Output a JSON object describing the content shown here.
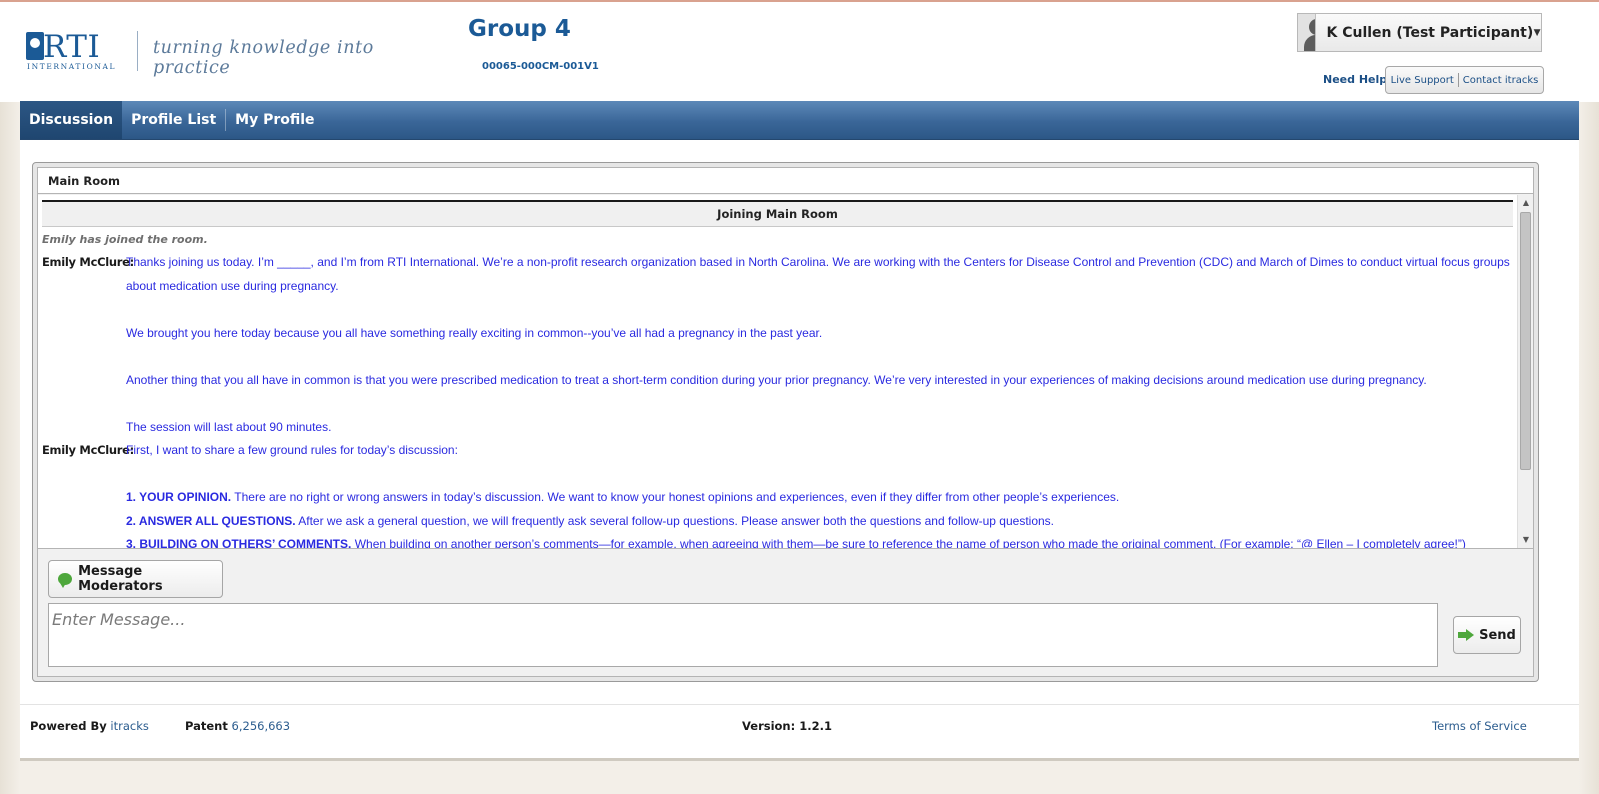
{
  "header": {
    "logo_text": "RTI",
    "logo_subtext": "INTERNATIONAL",
    "tagline": "turning knowledge into practice",
    "group_title": "Group 4",
    "group_code": "00065-000CM-001V1",
    "user_name": "K Cullen (Test Participant)",
    "need_help": "Need Help?",
    "live_support": "Live Support",
    "contact": "Contact itracks"
  },
  "nav": {
    "tabs": [
      {
        "label": "Discussion",
        "active": true
      },
      {
        "label": "Profile List",
        "active": false
      },
      {
        "label": "My Profile",
        "active": false
      }
    ]
  },
  "room": {
    "name": "Main Room",
    "joining_banner": "Joining Main Room",
    "system_message": "Emily has joined the room."
  },
  "messages": [
    {
      "author": "Emily McClure:",
      "paragraphs": [
        "Thanks joining us today. I’m _____, and I’m from RTI International. We’re a non-profit research organization based in North Carolina. We are working with the Centers for Disease Control and Prevention (CDC) and March of Dimes to conduct virtual focus groups about medication use during pregnancy.",
        "We brought you here today because you all have something really exciting in common--you’ve all had a pregnancy in the past year.",
        "Another thing that you all have in common is that you were prescribed medication to treat a short-term condition during your prior pregnancy. We’re very interested in your experiences of making decisions around medication use during pregnancy.",
        "The session will last about 90 minutes."
      ]
    },
    {
      "author": "Emily McClure:",
      "intro": "First, I want to share a few ground rules for today’s discussion:",
      "rules": [
        {
          "title": "1. YOUR OPINION.",
          "text": "There are no right or wrong answers in today’s discussion. We want to know your honest opinions and experiences, even if they differ from other people’s experiences."
        },
        {
          "title": "2. ANSWER ALL QUESTIONS.",
          "text": "After we ask a general question, we will frequently ask several follow-up questions. Please answer both the questions and follow-up questions."
        },
        {
          "title": "3. BUILDING ON OTHERS’ COMMENTS.",
          "text": "When building on another person’s comments—for example, when agreeing with them—be sure to reference the name of person who made the original comment. (For example: “@ Ellen – I completely agree!”)"
        }
      ]
    }
  ],
  "composer": {
    "moderators_button": "Message Moderators",
    "placeholder": "Enter Message...",
    "send_button": "Send"
  },
  "footer": {
    "powered_label": "Powered By",
    "powered_link": "itracks",
    "patent_label": "Patent",
    "patent_number": "6,256,663",
    "version": "Version: 1.2.1",
    "terms": "Terms of Service"
  },
  "colors": {
    "brand_blue": "#1b5a96",
    "nav_blue": "#3a6698",
    "message_text": "#2a2ae0"
  }
}
